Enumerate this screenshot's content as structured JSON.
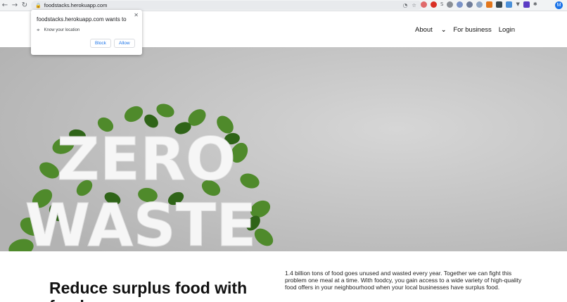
{
  "browser": {
    "url": "foodstacks.herokuapp.com",
    "profile_initial": "M"
  },
  "permission_popup": {
    "title": "foodstacks.herokuapp.com wants to",
    "permission": "Know your location",
    "block_label": "Block",
    "allow_label": "Allow"
  },
  "nav": {
    "about": "About",
    "business": "For business",
    "login": "Login"
  },
  "hero": {
    "word1": "ZERO",
    "word2": "WASTE"
  },
  "content": {
    "headline_line1": "Reduce surplus food with",
    "headline_line2": "foodcy",
    "body": "1.4 billion tons of food goes unused and wasted every year. Together we can fight this problem one meal at a time. With foodcy, you gain access to a wide variety of high-quality food offers in your neighbourhood when your local businesses have surplus food."
  },
  "colors": {
    "leaf": "#4f8a2b",
    "leaf_dark": "#2f6418",
    "hero_bg": "#c4c4c4",
    "link_blue": "#1a73e8"
  }
}
